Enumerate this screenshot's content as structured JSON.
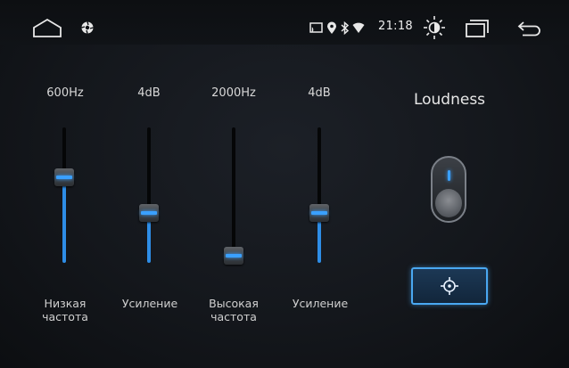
{
  "status_bar": {
    "time": "21:18",
    "icons": [
      "home-icon",
      "gear-icon",
      "screen-cast-icon",
      "location-pin-icon",
      "bluetooth-icon",
      "wifi-icon",
      "brightness-icon",
      "recent-apps-icon",
      "back-icon"
    ]
  },
  "equalizer": {
    "bands": [
      {
        "value": "600Hz",
        "label_line1": "Низкая",
        "label_line2": "частота",
        "level": 0.63
      },
      {
        "value": "4dB",
        "label_line1": "Усиление",
        "label_line2": "",
        "level": 0.37
      },
      {
        "value": "2000Hz",
        "label_line1": "Высокая",
        "label_line2": "частота",
        "level": 0.05
      },
      {
        "value": "4dB",
        "label_line1": "Усиление",
        "label_line2": "",
        "level": 0.37
      }
    ]
  },
  "loudness": {
    "title": "Loudness",
    "enabled": true
  },
  "colors": {
    "accent": "#2e8de6",
    "background": "#14171c"
  }
}
